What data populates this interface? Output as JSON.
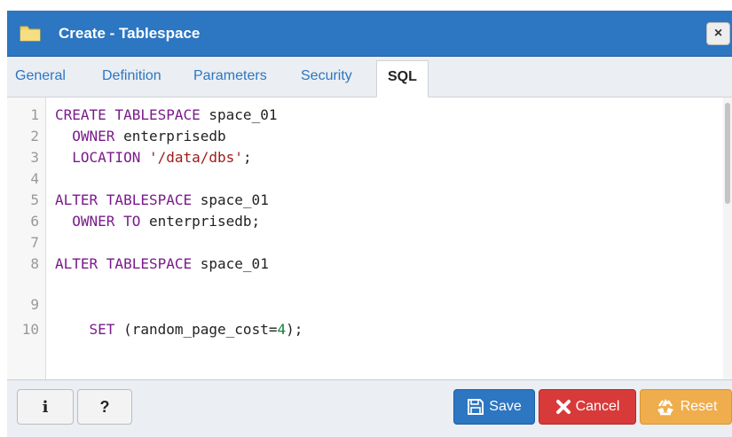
{
  "dialog": {
    "title": "Create - Tablespace",
    "close_label": "×",
    "title_icon": "folder-icon"
  },
  "tabs": [
    {
      "label": "General",
      "active": false
    },
    {
      "label": "Definition",
      "active": false
    },
    {
      "label": "Parameters",
      "active": false
    },
    {
      "label": "Security",
      "active": false
    },
    {
      "label": "SQL",
      "active": true
    }
  ],
  "editor": {
    "line_numbers": [
      "1",
      "2",
      "3",
      "4",
      "5",
      "6",
      "7",
      "8",
      "9",
      "10"
    ],
    "lines": [
      {
        "kw": "CREATE TABLESPACE",
        "rest": " space_01"
      },
      {
        "indent": "  ",
        "kw": "OWNER",
        "rest": " enterprisedb"
      },
      {
        "indent": "  ",
        "kw": "LOCATION",
        "str": "'/data/dbs'",
        "rest": ";"
      },
      {},
      {
        "kw": "ALTER TABLESPACE",
        "rest": " space_01"
      },
      {
        "indent": "  ",
        "kw": "OWNER TO",
        "rest": " enterprisedb;"
      },
      {},
      {
        "kw": "ALTER TABLESPACE",
        "rest": " space_01"
      },
      {},
      {
        "indent": "    ",
        "kw": "SET",
        "rest": " (random_page_cost=",
        "num": "4",
        "tail": ");"
      }
    ]
  },
  "footer": {
    "info_label": "i",
    "help_label": "?",
    "save_label": "Save",
    "cancel_label": "Cancel",
    "reset_label": "Reset"
  },
  "colors": {
    "header": "#2c76c2",
    "save": "#2c76c2",
    "cancel": "#d83a3a",
    "reset": "#f0ad4e",
    "keyword": "#7a1b8a",
    "string": "#a11a1a",
    "number": "#11803a"
  }
}
